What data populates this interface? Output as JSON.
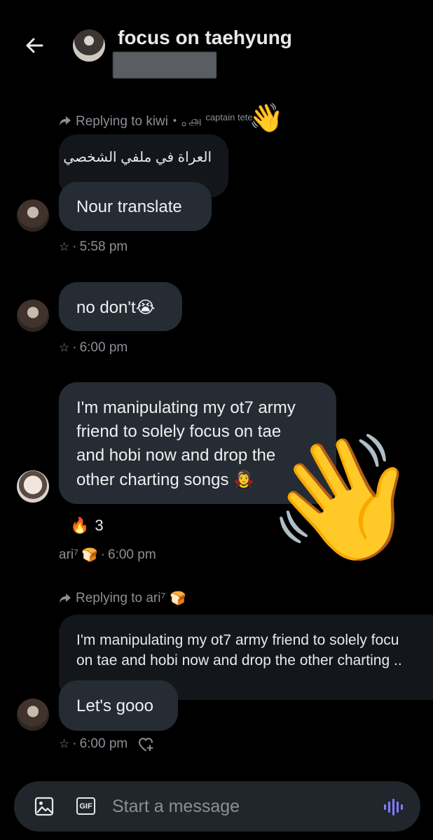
{
  "header": {
    "title": "focus on taehyung"
  },
  "messages": [
    {
      "replying_to": "Replying to kiwi・｡௮",
      "replying_to_extra": "captain tete",
      "quoted_text": "العراة في ملفي الشخصي",
      "text": "Nour translate",
      "time": "5:58 pm"
    },
    {
      "text": "no don't",
      "emoji": "😭",
      "time": "6:00 pm"
    },
    {
      "lines": [
        "I'm manipulating my ot7 army",
        "friend to solely focus on tae",
        "and hobi now and drop the",
        "other charting songs"
      ],
      "emoji": "🧛‍♀️",
      "reaction_emoji": "🔥",
      "reaction_count": "3",
      "sender": "ari⁷",
      "sender_emoji": "🍞",
      "time": "6:00 pm"
    },
    {
      "replying_to": "Replying to ari⁷",
      "replying_to_emoji": "🍞",
      "quoted_lines": [
        "I'm manipulating my ot7 army friend to solely focu",
        "on tae and hobi now and drop the other charting .."
      ],
      "text": "Let's gooo",
      "time": "6:00 pm"
    }
  ],
  "composer": {
    "placeholder": "Start a message",
    "gif_label": "GIF"
  },
  "overlay_emoji": "👋",
  "colors": {
    "background": "#000000",
    "bubble": "#262c33",
    "quoted": "#13171b",
    "accent": "#7f7cff",
    "muted": "#8b9096"
  }
}
